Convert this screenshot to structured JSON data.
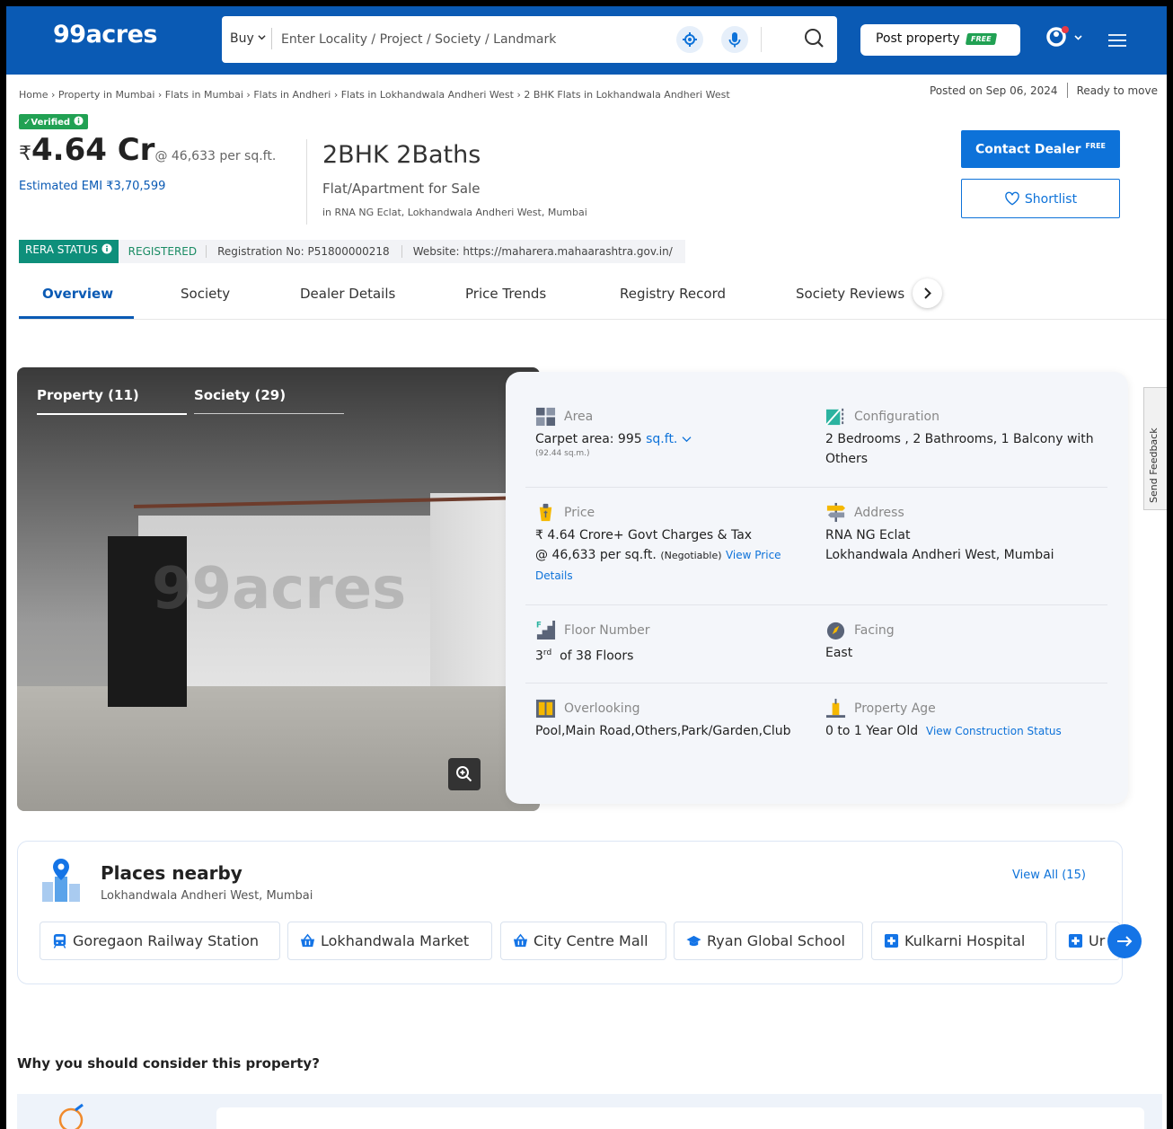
{
  "header": {
    "logo": "99acres",
    "buy_label": "Buy",
    "search_placeholder": "Enter Locality / Project / Society / Landmark",
    "post_label": "Post property",
    "post_badge": "FREE",
    "colors": {
      "header_bg": "#0a5ab4",
      "accent": "#0d72d9",
      "green": "#21a153"
    }
  },
  "breadcrumb": "Home › Property in Mumbai › Flats in Mumbai › Flats in Andheri › Flats in Lokhandwala Andheri West › 2 BHK Flats in Lokhandwala Andheri West",
  "posted": {
    "date": "Posted on Sep 06, 2024",
    "status": "Ready to move"
  },
  "listing": {
    "verified": "✓Verified",
    "currency": "₹",
    "price": "4.64 Cr",
    "per_sqft": "@ 46,633 per sq.ft.",
    "emi": "Estimated EMI ₹3,70,599",
    "config": "2BHK 2Baths",
    "type": "Flat/Apartment for Sale",
    "location": "in RNA NG Eclat, Lokhandwala Andheri West, Mumbai",
    "contact_label": "Contact Dealer",
    "contact_badge": "FREE",
    "shortlist_label": "Shortlist"
  },
  "rera": {
    "badge": "RERA STATUS",
    "status": "REGISTERED",
    "reg_no": "Registration No: P51800000218",
    "website": "Website: https://maharera.mahaarashtra.gov.in/"
  },
  "tabs": [
    "Overview",
    "Society",
    "Dealer Details",
    "Price Trends",
    "Registry Record",
    "Society Reviews"
  ],
  "gallery": {
    "tab1": "Property (11)",
    "tab2": "Society (29)",
    "watermark": "99acres"
  },
  "details": {
    "area": {
      "label": "Area",
      "value": "Carpet area: 995",
      "unit": "sq.ft.",
      "sub": "(92.44 sq.m.)"
    },
    "config": {
      "label": "Configuration",
      "value": "2 Bedrooms , 2 Bathrooms, 1 Balcony with Others"
    },
    "price": {
      "label": "Price",
      "line1": "₹ 4.64 Crore+ Govt Charges & Tax",
      "line2": "@ 46,633 per sq.ft.",
      "neg": "(Negotiable)",
      "link": "View Price Details"
    },
    "address": {
      "label": "Address",
      "line1": "RNA NG Eclat",
      "line2": "Lokhandwala Andheri West, Mumbai"
    },
    "floor": {
      "label": "Floor Number",
      "num": "3",
      "ord": "rd",
      "rest": "of 38 Floors"
    },
    "facing": {
      "label": "Facing",
      "value": "East"
    },
    "overlooking": {
      "label": "Overlooking",
      "value": "Pool,Main Road,Others,Park/Garden,Club"
    },
    "age": {
      "label": "Property Age",
      "value": "0 to 1 Year Old",
      "link": "View Construction Status"
    }
  },
  "places": {
    "title": "Places nearby",
    "sub": "Lokhandwala Andheri West, Mumbai",
    "view_all": "View All (15)",
    "items": [
      {
        "name": "Goregaon Railway Station",
        "icon": "train-icon"
      },
      {
        "name": "Lokhandwala Market",
        "icon": "basket-icon"
      },
      {
        "name": "City Centre Mall",
        "icon": "basket-icon"
      },
      {
        "name": "Ryan Global School",
        "icon": "graduation-cap-icon"
      },
      {
        "name": "Kulkarni Hospital",
        "icon": "hospital-cross-icon"
      },
      {
        "name": "Ur",
        "icon": "hospital-cross-icon"
      }
    ]
  },
  "why_title": "Why you should consider this property?",
  "feedback": "Send Feedback"
}
